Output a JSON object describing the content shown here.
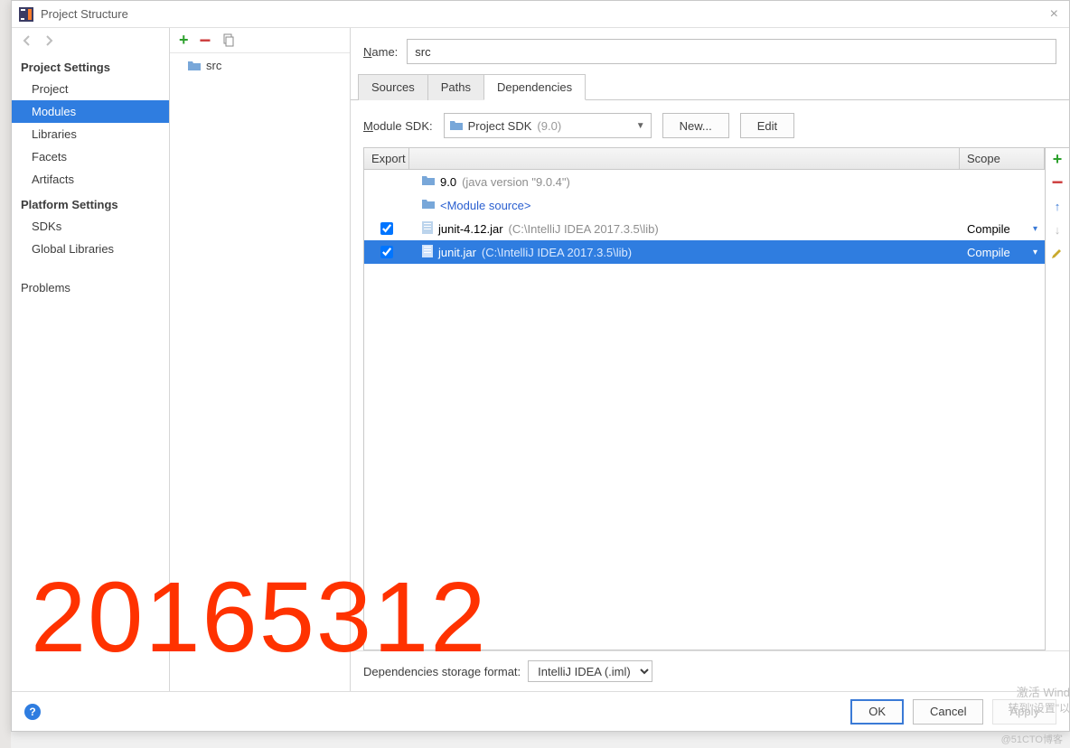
{
  "window": {
    "title": "Project Structure"
  },
  "sidebar": {
    "sections": [
      {
        "header": "Project Settings",
        "items": [
          "Project",
          "Modules",
          "Libraries",
          "Facets",
          "Artifacts"
        ],
        "selectedIndex": 1
      },
      {
        "header": "Platform Settings",
        "items": [
          "SDKs",
          "Global Libraries"
        ]
      }
    ],
    "problems": "Problems"
  },
  "modules": {
    "list": [
      {
        "name": "src"
      }
    ]
  },
  "main": {
    "nameLabel": "Name:",
    "nameValue": "src",
    "tabs": [
      "Sources",
      "Paths",
      "Dependencies"
    ],
    "activeTab": 2,
    "sdkLabel": "Module SDK:",
    "sdkValue": "Project SDK",
    "sdkVersion": "(9.0)",
    "newBtn": "New...",
    "editBtn": "Edit",
    "columns": {
      "export": "Export",
      "scope": "Scope"
    },
    "dependencies": [
      {
        "export": null,
        "name": "9.0",
        "detail": "(java version \"9.0.4\")",
        "icon": "sdk",
        "scope": ""
      },
      {
        "export": null,
        "name": "<Module source>",
        "icon": "folder",
        "link": true,
        "scope": ""
      },
      {
        "export": true,
        "name": "junit-4.12.jar",
        "detail": "(C:\\IntelliJ IDEA 2017.3.5\\lib)",
        "icon": "jar",
        "scope": "Compile"
      },
      {
        "export": true,
        "name": "junit.jar",
        "detail": "(C:\\IntelliJ IDEA 2017.3.5\\lib)",
        "icon": "jar",
        "scope": "Compile",
        "selected": true
      }
    ],
    "storageLabel": "Dependencies storage format:",
    "storageValue": "IntelliJ IDEA (.iml)"
  },
  "footer": {
    "ok": "OK",
    "cancel": "Cancel",
    "apply": "Apply"
  },
  "overlay": {
    "number": "20165312"
  },
  "watermark": {
    "line1": "激活 Wind",
    "line2": "转到\"设置\"以"
  },
  "blogTag": "@51CTO博客"
}
